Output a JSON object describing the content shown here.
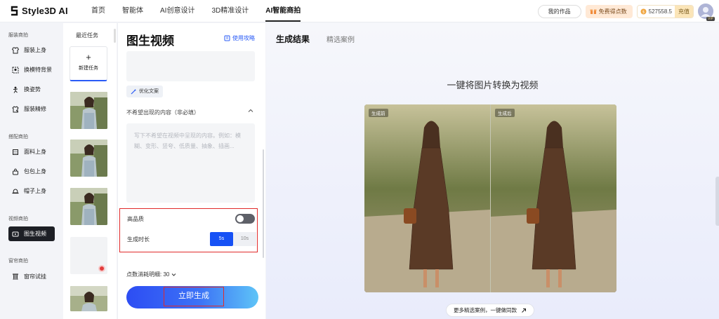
{
  "header": {
    "logo_text": "Style3D AI",
    "nav": [
      "首页",
      "智能体",
      "AI创意设计",
      "3D精准设计",
      "AI智能商拍"
    ],
    "active_nav": 4,
    "my_works": "我的作品",
    "free_points": "免费得点数",
    "points": "527558.5",
    "recharge": "充值",
    "vip": "VIP"
  },
  "sidebar": {
    "groups": [
      {
        "title": "服装商拍",
        "items": [
          {
            "label": "服装上身",
            "icon": "shirt-icon"
          },
          {
            "label": "换模特背景",
            "icon": "swap-model-icon"
          },
          {
            "label": "换姿势",
            "icon": "pose-icon"
          },
          {
            "label": "服装精修",
            "icon": "retouch-icon"
          }
        ]
      },
      {
        "title": "搭配商拍",
        "items": [
          {
            "label": "面料上身",
            "icon": "fabric-icon"
          },
          {
            "label": "包包上身",
            "icon": "bag-icon"
          },
          {
            "label": "帽子上身",
            "icon": "hat-icon"
          }
        ]
      },
      {
        "title": "视频商拍",
        "items": [
          {
            "label": "图生视频",
            "icon": "video-icon"
          }
        ]
      },
      {
        "title": "窗帘商拍",
        "items": [
          {
            "label": "窗帘试挂",
            "icon": "curtain-icon"
          }
        ]
      }
    ]
  },
  "recent": {
    "title": "最近任务",
    "new_task": "新建任务",
    "new_task_icon": "+"
  },
  "form": {
    "title": "图生视频",
    "guide": "使用攻略",
    "optimize": "优化文案",
    "negative_label": "不希望出现的内容（非必填）",
    "negative_placeholder": "写下不希望在视频中呈现的内容。例如：模糊、变形、竖夸、低质量、抽象、插画...",
    "high_quality_label": "高品质",
    "high_quality_on": false,
    "duration_label": "生成时长",
    "durations": [
      "5s",
      "10s"
    ],
    "selected_duration": 0,
    "cost_label": "点数消耗明细: 30",
    "generate": "立即生成"
  },
  "result": {
    "tabs": [
      "生成结果",
      "精选案例"
    ],
    "headline": "一键将图片转换为视频",
    "before": "生成前",
    "after": "生成后",
    "more": "更多精选案例，一键做同款"
  },
  "colors": {
    "accent": "#1651f5",
    "highlight_box": "#e12a2a",
    "active_sidebar": "#1d1f25"
  }
}
